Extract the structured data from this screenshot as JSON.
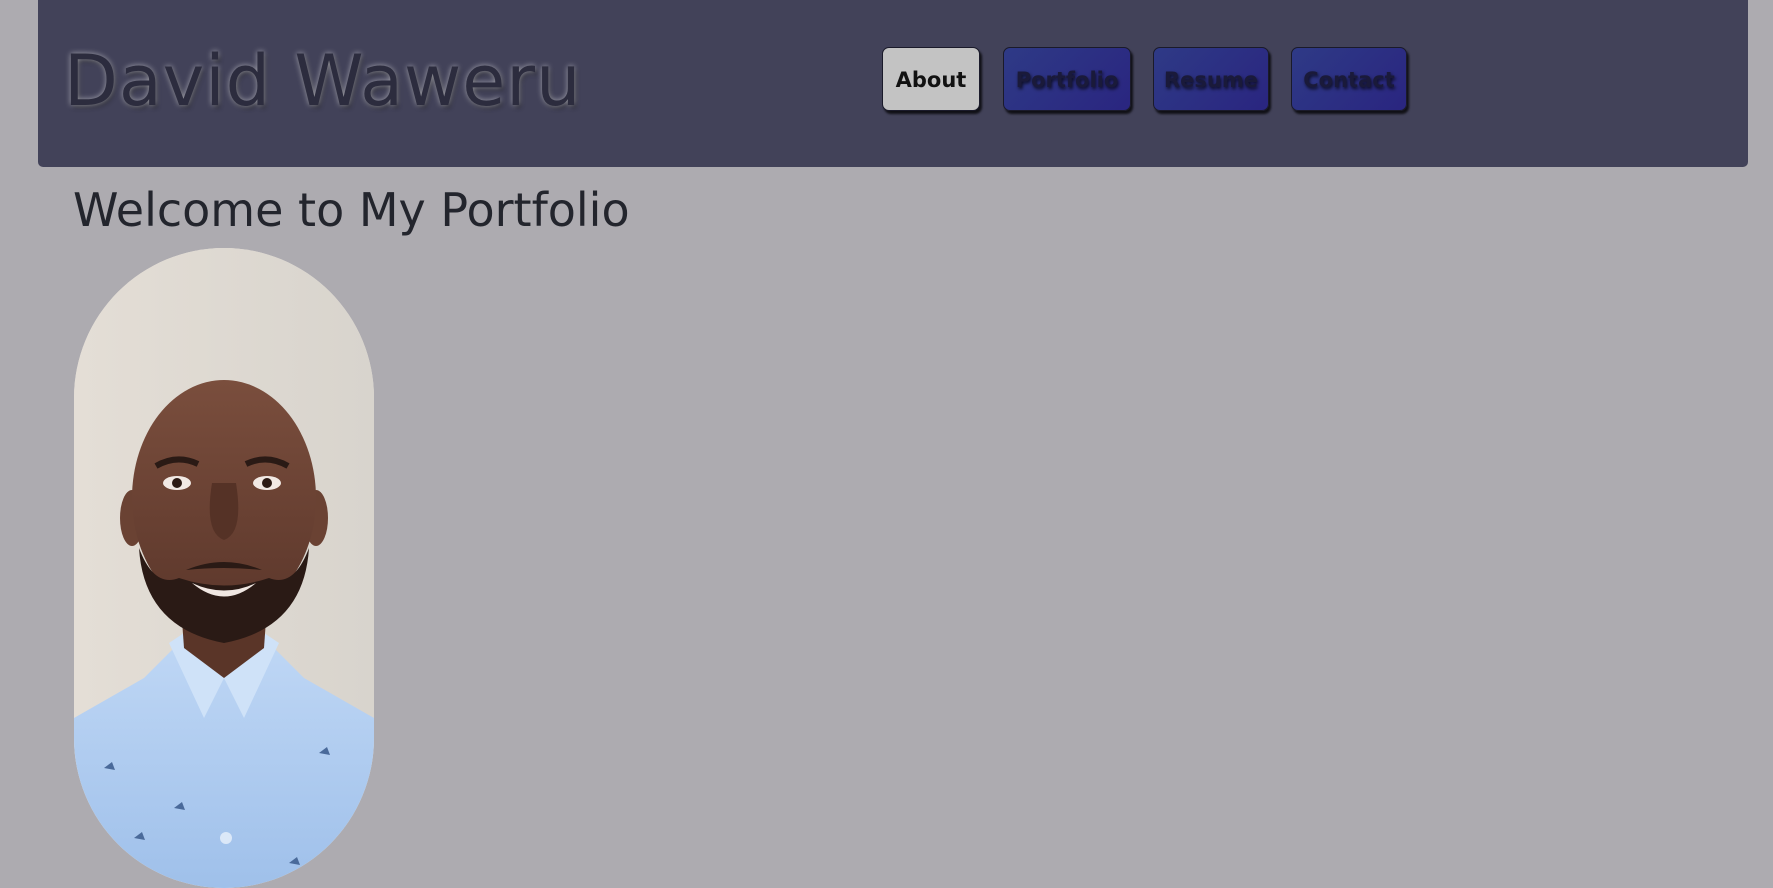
{
  "header": {
    "title": "David Waweru"
  },
  "nav": {
    "items": [
      {
        "label": "About",
        "active": true
      },
      {
        "label": "Portfolio",
        "active": false
      },
      {
        "label": "Resume",
        "active": false
      },
      {
        "label": "Contact",
        "active": false
      }
    ]
  },
  "main": {
    "heading": "Welcome to My Portfolio",
    "photo_alt": "Portrait photo of David Waweru"
  },
  "colors": {
    "page_background": "#adabb0",
    "header_background": "#424259",
    "active_button": "#c3c3c3",
    "inactive_button": "#2a2580"
  }
}
